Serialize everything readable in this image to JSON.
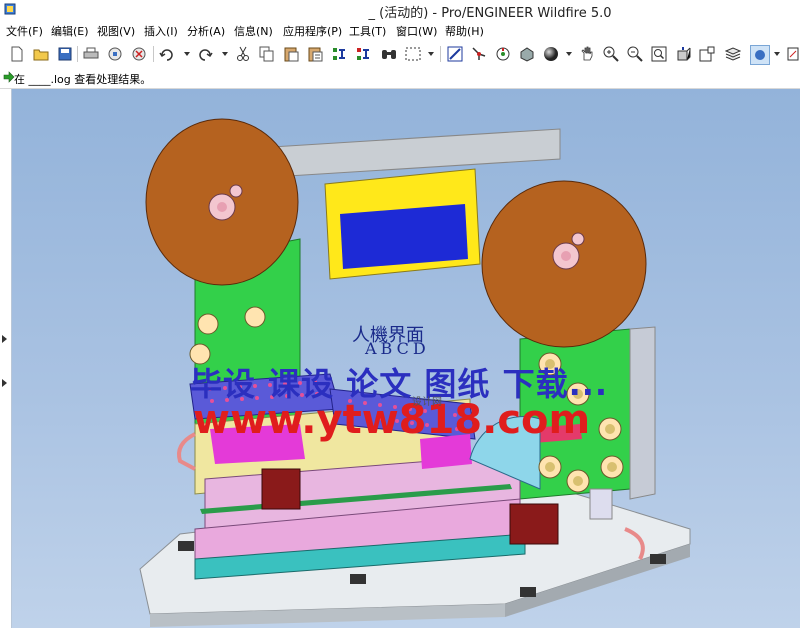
{
  "window": {
    "title": "_ (活动的) - Pro/ENGINEER Wildfire 5.0"
  },
  "menu": {
    "items": [
      "文件(F)",
      "编辑(E)",
      "视图(V)",
      "插入(I)",
      "分析(A)",
      "信息(N)",
      "应用程序(P)",
      "工具(T)",
      "窗口(W)",
      "帮助(H)"
    ]
  },
  "toolbar": {
    "icons": [
      "new-icon",
      "open-icon",
      "save-icon",
      "print-icon",
      "save-copy-icon",
      "erase-icon",
      "undo-icon",
      "redo-icon",
      "cut-icon",
      "copy-icon",
      "paste-icon",
      "paste-special-icon",
      "regenerate-icon",
      "regen-manager-icon",
      "find-icon",
      "select-box-icon",
      "repaint-icon",
      "spin-center-icon",
      "orientation-icon",
      "saved-views-icon",
      "shading-icon",
      "pan-icon",
      "zoom-in-icon",
      "zoom-out-icon",
      "refit-icon",
      "reorient-icon",
      "view-manager-icon",
      "layers-icon",
      "display-style-icon"
    ]
  },
  "message": {
    "text": "在 ____.log 查看处理结果。"
  },
  "model": {
    "panel_line1": "人機界面",
    "panel_line2": "ABCD"
  },
  "watermark": {
    "line1": "毕设 课设 论文 图纸 下载...",
    "line2": "www.ytw818.com",
    "small": "设计网"
  },
  "colors": {
    "viewport_top": "#93b3da",
    "viewport_bottom": "#bfd2ea",
    "reel": "#b5621f",
    "frame_green": "#33d04a",
    "panel_yellow": "#ffe81a",
    "plate_blue": "#5a5ad8",
    "watermark_blue": "#2b2fbf",
    "watermark_red": "#e01d1d"
  }
}
